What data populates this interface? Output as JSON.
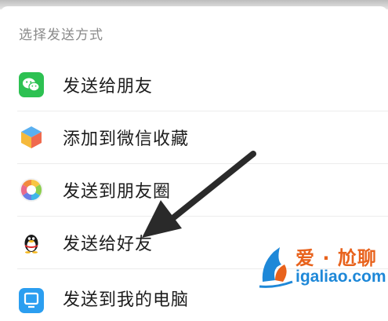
{
  "sheet": {
    "title": "选择发送方式",
    "items": [
      {
        "label": "发送给朋友",
        "icon": "wechat-icon"
      },
      {
        "label": "添加到微信收藏",
        "icon": "favorites-cube-icon"
      },
      {
        "label": "发送到朋友圈",
        "icon": "moments-aperture-icon"
      },
      {
        "label": "发送给好友",
        "icon": "qq-penguin-icon"
      },
      {
        "label": "发送到我的电脑",
        "icon": "my-computer-icon"
      }
    ]
  },
  "watermark": {
    "line1": "爱 · 尬聊",
    "line2": "igaliao.com"
  },
  "colors": {
    "wechat_green": "#2dc152",
    "watermark_orange": "#e8621c",
    "watermark_blue": "#1e88d8"
  }
}
